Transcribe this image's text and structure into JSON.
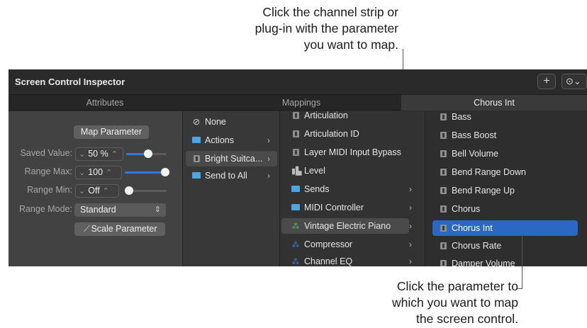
{
  "callouts": {
    "top_line1": "Click the channel strip or",
    "top_line2": "plug-in with the parameter",
    "top_line3": "you want to map.",
    "bottom_line1": "Click the parameter to",
    "bottom_line2": "which you want to map",
    "bottom_line3": "the screen control."
  },
  "window": {
    "title": "Screen Control Inspector",
    "add_button": "+",
    "more_button": "⊙⌄"
  },
  "tabs": {
    "attributes": "Attributes",
    "mappings": "Mappings",
    "selected_param": "Chorus Int"
  },
  "attributes": {
    "map_parameter_button": "Map Parameter",
    "saved_value_label": "Saved Value:",
    "saved_value": "50 %",
    "saved_value_level": 0.55,
    "range_max_label": "Range Max:",
    "range_max": "100",
    "range_max_level": 1.0,
    "range_min_label": "Range Min:",
    "range_min": "Off",
    "range_min_level": 0.0,
    "range_mode_label": "Range Mode:",
    "range_mode": "Standard",
    "scale_parameter_button": "Scale Parameter"
  },
  "actions_column": [
    {
      "label": "None",
      "icon": "none-icon"
    },
    {
      "label": "Actions",
      "icon": "folder-icon",
      "has_submenu": true
    },
    {
      "label": "Bright Suitca...",
      "icon": "channel-strip-icon",
      "has_submenu": true,
      "selected": true
    },
    {
      "label": "Send to All",
      "icon": "folder-icon",
      "has_submenu": true
    }
  ],
  "plugins_column": [
    {
      "label": "Articulation",
      "icon": "parameter-icon"
    },
    {
      "label": "Articulation ID",
      "icon": "parameter-icon"
    },
    {
      "label": "Layer MIDI Input Bypass",
      "icon": "parameter-icon"
    },
    {
      "label": "Level",
      "icon": "level-icon"
    },
    {
      "label": "Sends",
      "icon": "folder-icon",
      "has_submenu": true
    },
    {
      "label": "MIDI Controller",
      "icon": "folder-icon",
      "has_submenu": true
    },
    {
      "label": "Vintage Electric Piano",
      "icon": "plugin-icon",
      "has_submenu": true,
      "selected": true
    },
    {
      "label": "Compressor",
      "icon": "plugin-icon",
      "has_submenu": true
    },
    {
      "label": "Channel EQ",
      "icon": "plugin-icon",
      "has_submenu": true
    }
  ],
  "params_column": [
    {
      "label": "Bass"
    },
    {
      "label": "Bass Boost"
    },
    {
      "label": "Bell Volume"
    },
    {
      "label": "Bend Range Down"
    },
    {
      "label": "Bend Range Up"
    },
    {
      "label": "Chorus"
    },
    {
      "label": "Chorus Int",
      "selected": true
    },
    {
      "label": "Chorus Rate"
    },
    {
      "label": "Damper Volume"
    }
  ],
  "colors": {
    "accent": "#2a68c4",
    "slider_fill": "#2f7ae5",
    "folder": "#4aa6e8"
  }
}
